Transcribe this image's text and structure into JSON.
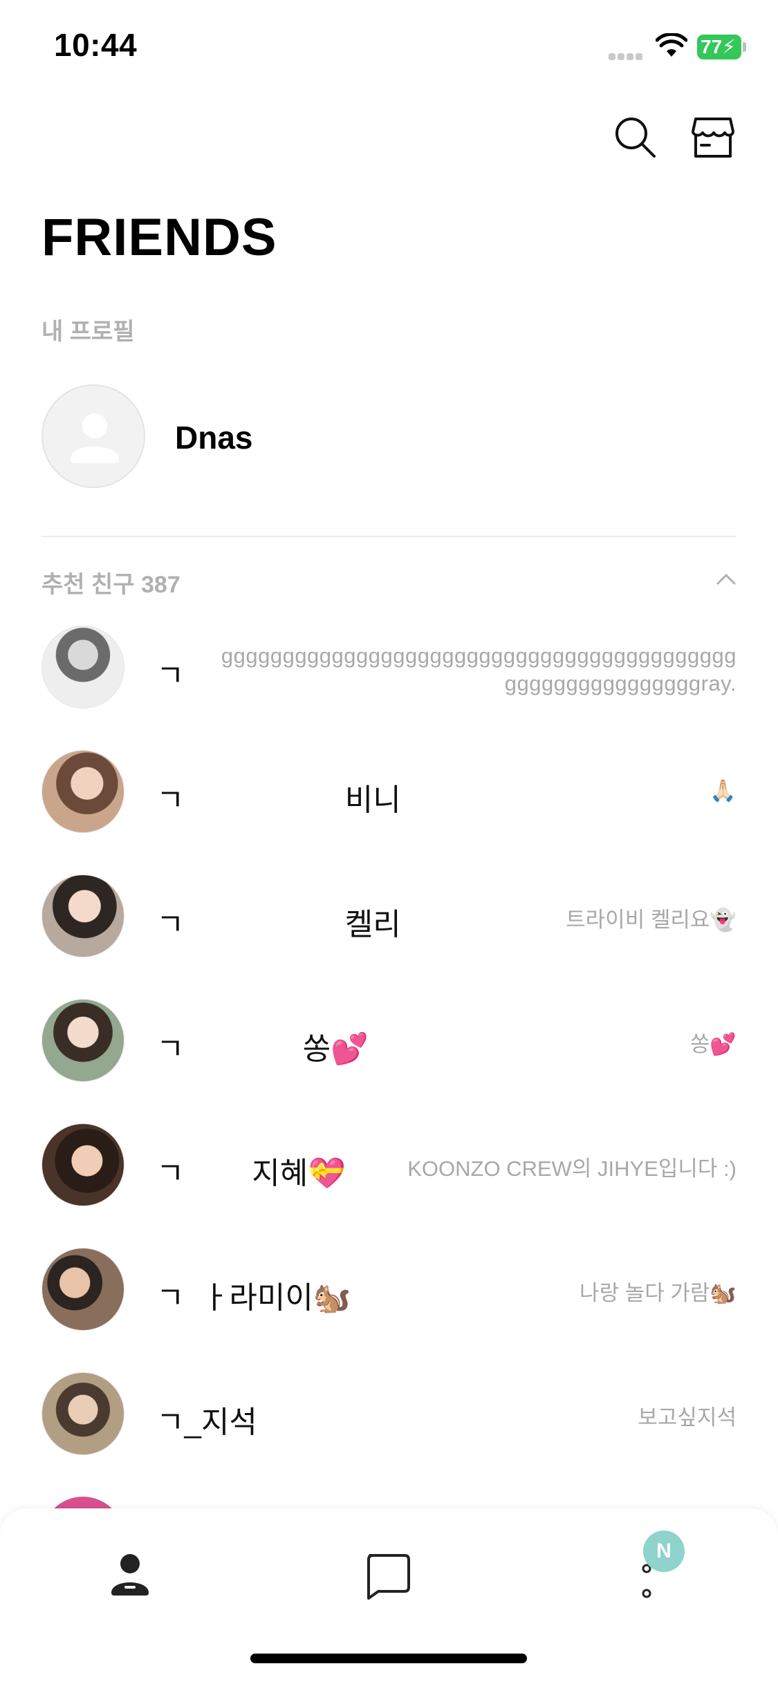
{
  "status_bar": {
    "time": "10:44",
    "battery": "77"
  },
  "header": {
    "title": "FRIENDS",
    "my_profile_label": "내 프로필"
  },
  "my_profile": {
    "name": "Dnas"
  },
  "recommended": {
    "label": "추천 친구 387",
    "friends": [
      {
        "name": "ㄱ",
        "status": "ggggggggggggggggggggggggggggggggggggggggggggggggggggggggggray.",
        "avatar_color": "#9a9a9a"
      },
      {
        "name": "ㄱ                   비니",
        "status": "🙏🏻",
        "avatar_color": "#b8876a"
      },
      {
        "name": "ㄱ                   켈리",
        "status": "트라이비 켈리요👻",
        "avatar_color": "#8c7a70"
      },
      {
        "name": "ㄱ              쏭💕",
        "status": "쏭💕",
        "avatar_color": "#7a8a78"
      },
      {
        "name": "ㄱ        지혜💝",
        "status": "KOONZO CREW의 JIHYE입니다 :)",
        "avatar_color": "#5a4034"
      },
      {
        "name": "ㄱ  ㅏ라미이🐿️",
        "status": "나랑 놀다 가람🐿️",
        "avatar_color": "#6e5b4f"
      },
      {
        "name": "ㄱ_지석",
        "status": "보고싶지석",
        "avatar_color": "#a89a86"
      }
    ]
  },
  "tab_bar": {
    "more_badge": "N"
  },
  "colors": {
    "battery": "#34c759",
    "badge": "#8fd3cc",
    "muted_text": "#a8a8a8"
  }
}
